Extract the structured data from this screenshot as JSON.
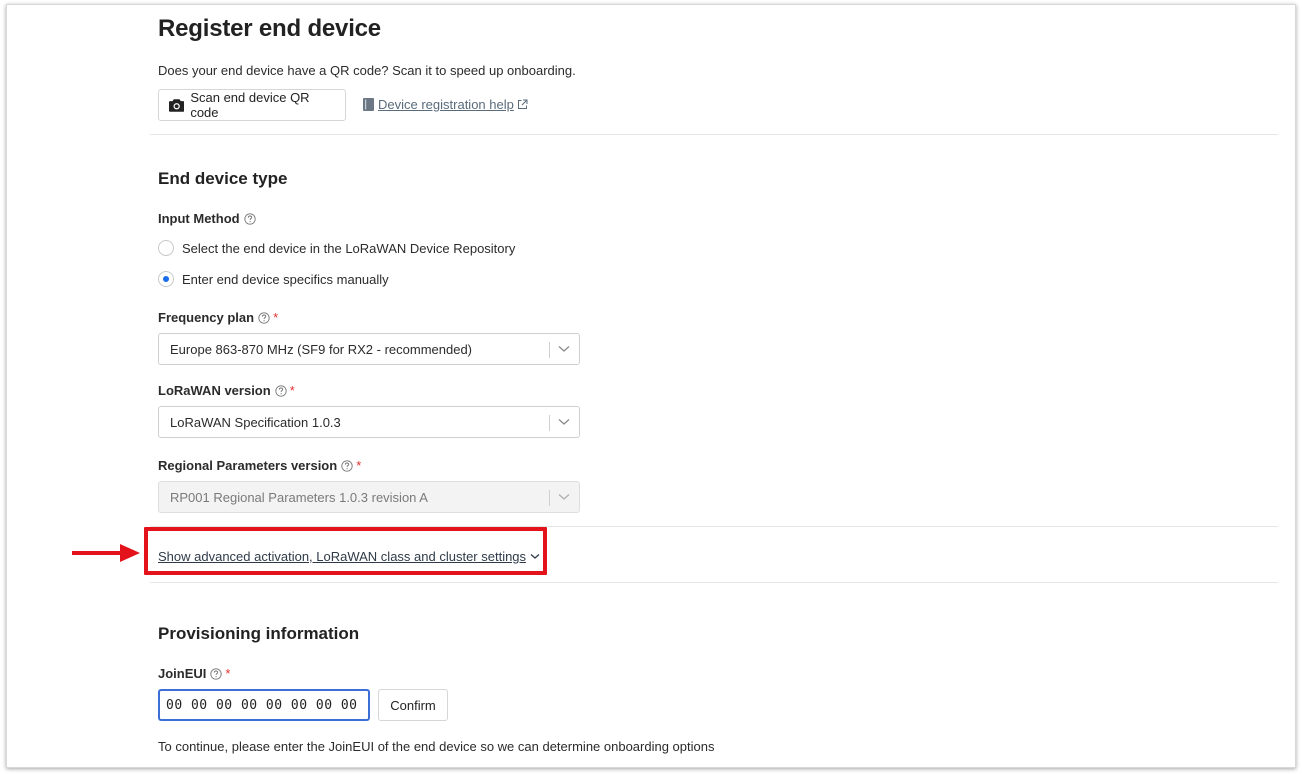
{
  "page": {
    "title": "Register end device",
    "qr_question": "Does your end device have a QR code? Scan it to speed up onboarding.",
    "scan_button_label": "Scan end device QR code",
    "help_link_label": "Device registration help"
  },
  "end_device_type": {
    "section_title": "End device type",
    "input_method_label": "Input Method",
    "input_method_options": [
      {
        "label": "Select the end device in the LoRaWAN Device Repository",
        "selected": false
      },
      {
        "label": "Enter end device specifics manually",
        "selected": true
      }
    ],
    "frequency_plan_label": "Frequency plan",
    "frequency_plan_value": "Europe 863-870 MHz (SF9 for RX2 - recommended)",
    "lorawan_version_label": "LoRaWAN version",
    "lorawan_version_value": "LoRaWAN Specification 1.0.3",
    "regional_params_label": "Regional Parameters version",
    "regional_params_value": "RP001 Regional Parameters 1.0.3 revision A",
    "required_marker": "*"
  },
  "advanced": {
    "link_label": "Show advanced activation, LoRaWAN class and cluster settings"
  },
  "provisioning": {
    "section_title": "Provisioning information",
    "joineui_label": "JoinEUI",
    "joineui_value": "00 00 00 00 00 00 00 00",
    "confirm_label": "Confirm",
    "hint": "To continue, please enter the JoinEUI of the end device so we can determine onboarding options"
  },
  "colors": {
    "accent": "#1a6dea",
    "required": "#e0322f",
    "highlight": "#e3121b"
  }
}
